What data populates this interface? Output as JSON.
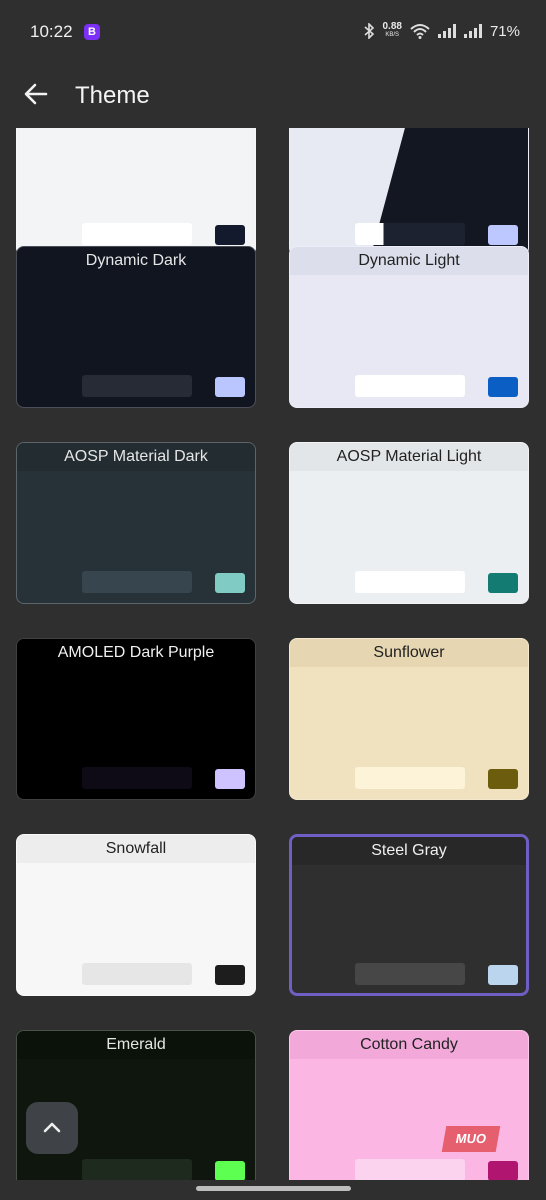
{
  "status": {
    "time": "10:22",
    "app_badge": "B",
    "speed": "0.88",
    "speed_unit": "KB/S",
    "battery": "71%"
  },
  "appbar": {
    "title": "Theme"
  },
  "themes": [
    {
      "name": "",
      "bg": "#f3f4f6",
      "header": "#f3f4f6",
      "text": "#222",
      "bar": "#ffffff",
      "swatch": "#141a2e"
    },
    {
      "name": "",
      "bg": "#e8eaf3",
      "header": "#e8eaf3",
      "text": "#222",
      "bar": "#1d2231",
      "swatch": "#bcc8ff",
      "split": "#121722"
    },
    {
      "name": "Dynamic Dark",
      "bg": "#101520",
      "header": "#101520",
      "text": "#e6e6e6",
      "bar": "#262b36",
      "swatch": "#b9c6ff"
    },
    {
      "name": "Dynamic Light",
      "bg": "#e7e8f4",
      "header": "#dcdfeb",
      "text": "#222",
      "bar": "#ffffff",
      "swatch": "#0b5fc4"
    },
    {
      "name": "AOSP Material Dark",
      "bg": "#263238",
      "header": "#222c31",
      "text": "#e6e6e6",
      "bar": "#37464e",
      "swatch": "#80cbc4"
    },
    {
      "name": "AOSP Material Light",
      "bg": "#eceff1",
      "header": "#e3e6e8",
      "text": "#222",
      "bar": "#ffffff",
      "swatch": "#137b71"
    },
    {
      "name": "AMOLED Dark Purple",
      "bg": "#000000",
      "header": "#000000",
      "text": "#f0f0f0",
      "bar": "#0e0b16",
      "swatch": "#cfc3ff"
    },
    {
      "name": "Sunflower",
      "bg": "#f1e2bf",
      "header": "#e6d6b1",
      "text": "#222",
      "bar": "#fdf3d8",
      "swatch": "#6b5d0d"
    },
    {
      "name": "Snowfall",
      "bg": "#f7f7f7",
      "header": "#ededed",
      "text": "#222",
      "bar": "#e6e6e6",
      "swatch": "#1d1d1d"
    },
    {
      "name": "Steel Gray",
      "bg": "#2f2f2f",
      "header": "#282828",
      "text": "#f0f0f0",
      "bar": "#474747",
      "swatch": "#bcd5ef",
      "selected": true
    },
    {
      "name": "Emerald",
      "bg": "#0e160e",
      "header": "#0a120a",
      "text": "#e6e6e6",
      "bar": "#1d2a1d",
      "swatch": "#5dff50"
    },
    {
      "name": "Cotton Candy",
      "bg": "#fbb6e4",
      "header": "#f2a9da",
      "text": "#222",
      "bar": "#fbd3ef",
      "swatch": "#b0166f"
    }
  ],
  "watermark": "MUO"
}
